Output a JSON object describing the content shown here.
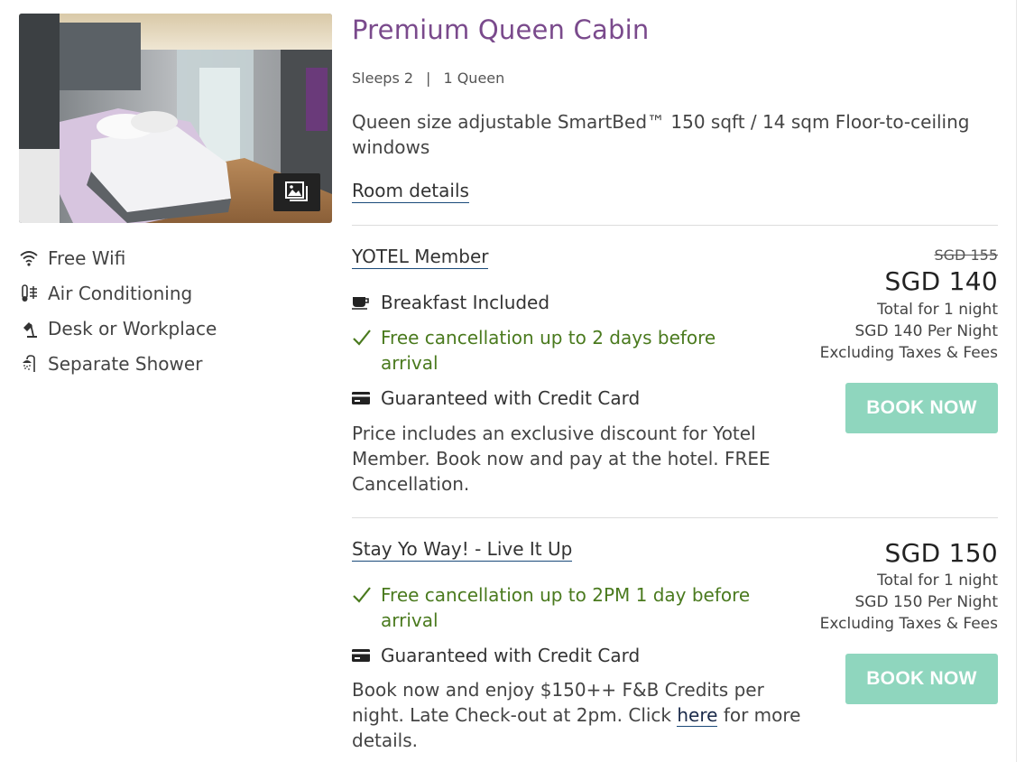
{
  "room": {
    "title": "Premium Queen Cabin",
    "sleeps": "Sleeps 2",
    "meta_separator": "|",
    "beds": "1 Queen",
    "description": "Queen size adjustable SmartBed™ 150 sqft / 14 sqm Floor-to-ceiling windows",
    "details_link": "Room details",
    "gallery_icon": "image-gallery-icon"
  },
  "amenities": [
    {
      "icon": "wifi-icon",
      "label": "Free Wifi"
    },
    {
      "icon": "air-conditioning-icon",
      "label": "Air Conditioning"
    },
    {
      "icon": "desk-lamp-icon",
      "label": "Desk or Workplace"
    },
    {
      "icon": "shower-icon",
      "label": "Separate Shower"
    }
  ],
  "rates": [
    {
      "name": "YOTEL Member",
      "features": [
        {
          "icon": "coffee-cup-icon",
          "text": "Breakfast Included",
          "style": "dark"
        },
        {
          "icon": "check-icon",
          "text": "Free cancellation up to 2 days before arrival",
          "style": "green"
        },
        {
          "icon": "credit-card-icon",
          "text": "Guaranteed with Credit Card",
          "style": "dark"
        }
      ],
      "description": "Price includes an exclusive discount for Yotel Member. Book now and pay at the hotel. FREE Cancellation.",
      "old_price": "SGD 155",
      "price": "SGD 140",
      "total_text": "Total for 1 night",
      "per_night": "SGD 140 Per Night",
      "taxes": "Excluding Taxes & Fees",
      "book_label": "BOOK NOW"
    },
    {
      "name": "Stay Yo Way! - Live It Up",
      "features": [
        {
          "icon": "check-icon",
          "text": "Free cancellation up to 2PM 1 day before arrival",
          "style": "green"
        },
        {
          "icon": "credit-card-icon",
          "text": "Guaranteed with Credit Card",
          "style": "dark"
        }
      ],
      "description_before": "Book now and enjoy $150++ F&B Credits per night. Late Check-out at 2pm. Click",
      "description_link": "here",
      "description_after": "for more details.",
      "price": "SGD 150",
      "total_text": "Total for 1 night",
      "per_night": "SGD 150 Per Night",
      "taxes": "Excluding Taxes & Fees",
      "book_label": "BOOK NOW"
    }
  ],
  "colors": {
    "title": "#7a4a8c",
    "green": "#4a7a1e",
    "button": "#8fd6be",
    "link_underline": "#1a4a7a"
  }
}
